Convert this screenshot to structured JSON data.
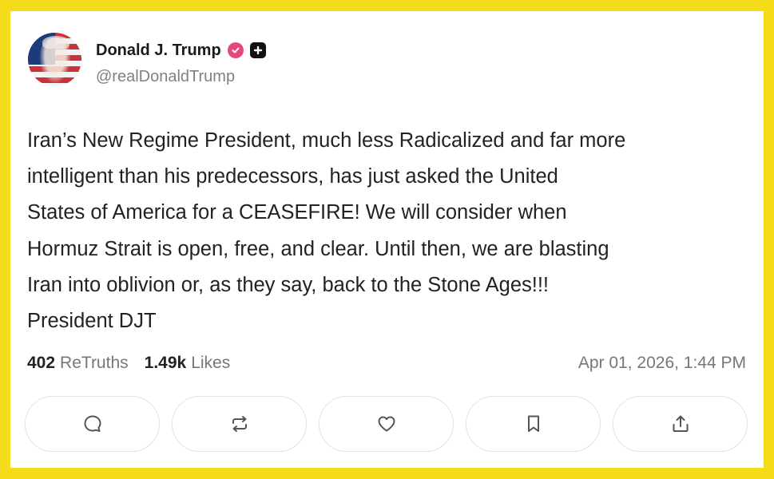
{
  "post": {
    "author": {
      "display_name": "Donald J. Trump",
      "handle": "@realDonaldTrump",
      "verified_icon": "verified-badge-icon",
      "badge_icon": "plus-badge-icon"
    },
    "body": "Iran’s New Regime President, much less Radicalized and far more\nintelligent than his predecessors, has just asked the United\nStates of America for a CEASEFIRE! We will consider when\nHormuz Strait is open, free, and clear. Until then, we are blasting\nIran into oblivion or, as they say, back to the Stone Ages!!!\nPresident DJT",
    "stats": {
      "retruths_count": "402",
      "retruths_label": "ReTruths",
      "likes_count": "1.49k",
      "likes_label": "Likes"
    },
    "timestamp": "Apr 01, 2026, 1:44 PM",
    "actions": [
      {
        "name": "reply",
        "icon": "comment-icon"
      },
      {
        "name": "retruth",
        "icon": "repost-icon"
      },
      {
        "name": "like",
        "icon": "heart-icon"
      },
      {
        "name": "bookmark",
        "icon": "bookmark-icon"
      },
      {
        "name": "share",
        "icon": "share-icon"
      }
    ]
  },
  "colors": {
    "frame": "#f5dc1b",
    "card": "#ffffff",
    "verified": "#e5497b",
    "text": "#222222",
    "muted": "#777777"
  }
}
